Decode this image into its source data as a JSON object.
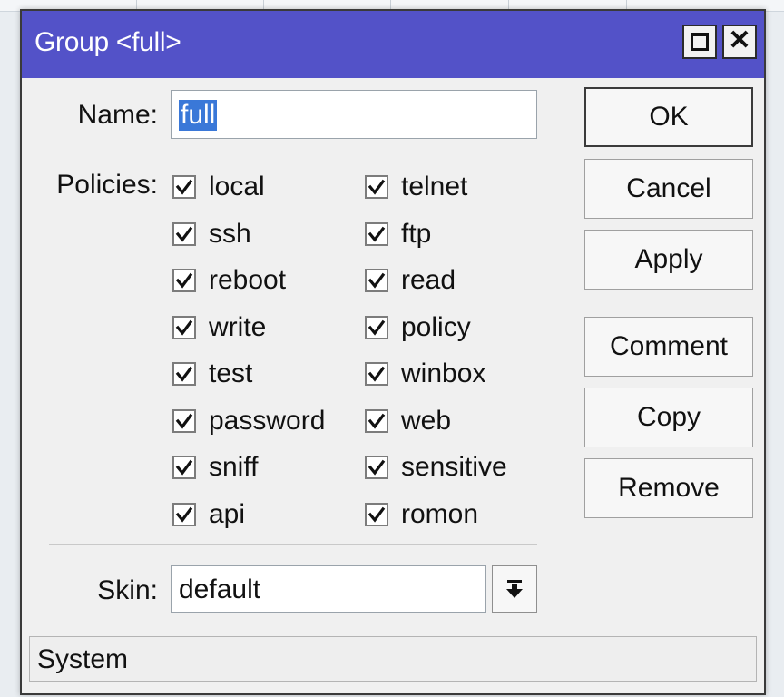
{
  "window": {
    "title": "Group <full>"
  },
  "form": {
    "name_label": "Name:",
    "name_value": "full",
    "policies_label": "Policies:",
    "skin_label": "Skin:",
    "skin_value": "default"
  },
  "policies": {
    "left": [
      {
        "label": "local",
        "checked": true
      },
      {
        "label": "ssh",
        "checked": true
      },
      {
        "label": "reboot",
        "checked": true
      },
      {
        "label": "write",
        "checked": true
      },
      {
        "label": "test",
        "checked": true
      },
      {
        "label": "password",
        "checked": true
      },
      {
        "label": "sniff",
        "checked": true
      },
      {
        "label": "api",
        "checked": true
      }
    ],
    "right": [
      {
        "label": "telnet",
        "checked": true
      },
      {
        "label": "ftp",
        "checked": true
      },
      {
        "label": "read",
        "checked": true
      },
      {
        "label": "policy",
        "checked": true
      },
      {
        "label": "winbox",
        "checked": true
      },
      {
        "label": "web",
        "checked": true
      },
      {
        "label": "sensitive",
        "checked": true
      },
      {
        "label": "romon",
        "checked": true
      }
    ]
  },
  "buttons": {
    "ok": "OK",
    "cancel": "Cancel",
    "apply": "Apply",
    "comment": "Comment",
    "copy": "Copy",
    "remove": "Remove"
  },
  "status": {
    "text": "System"
  },
  "colors": {
    "titlebar": "#5352c8",
    "selection": "#3a78d8"
  }
}
